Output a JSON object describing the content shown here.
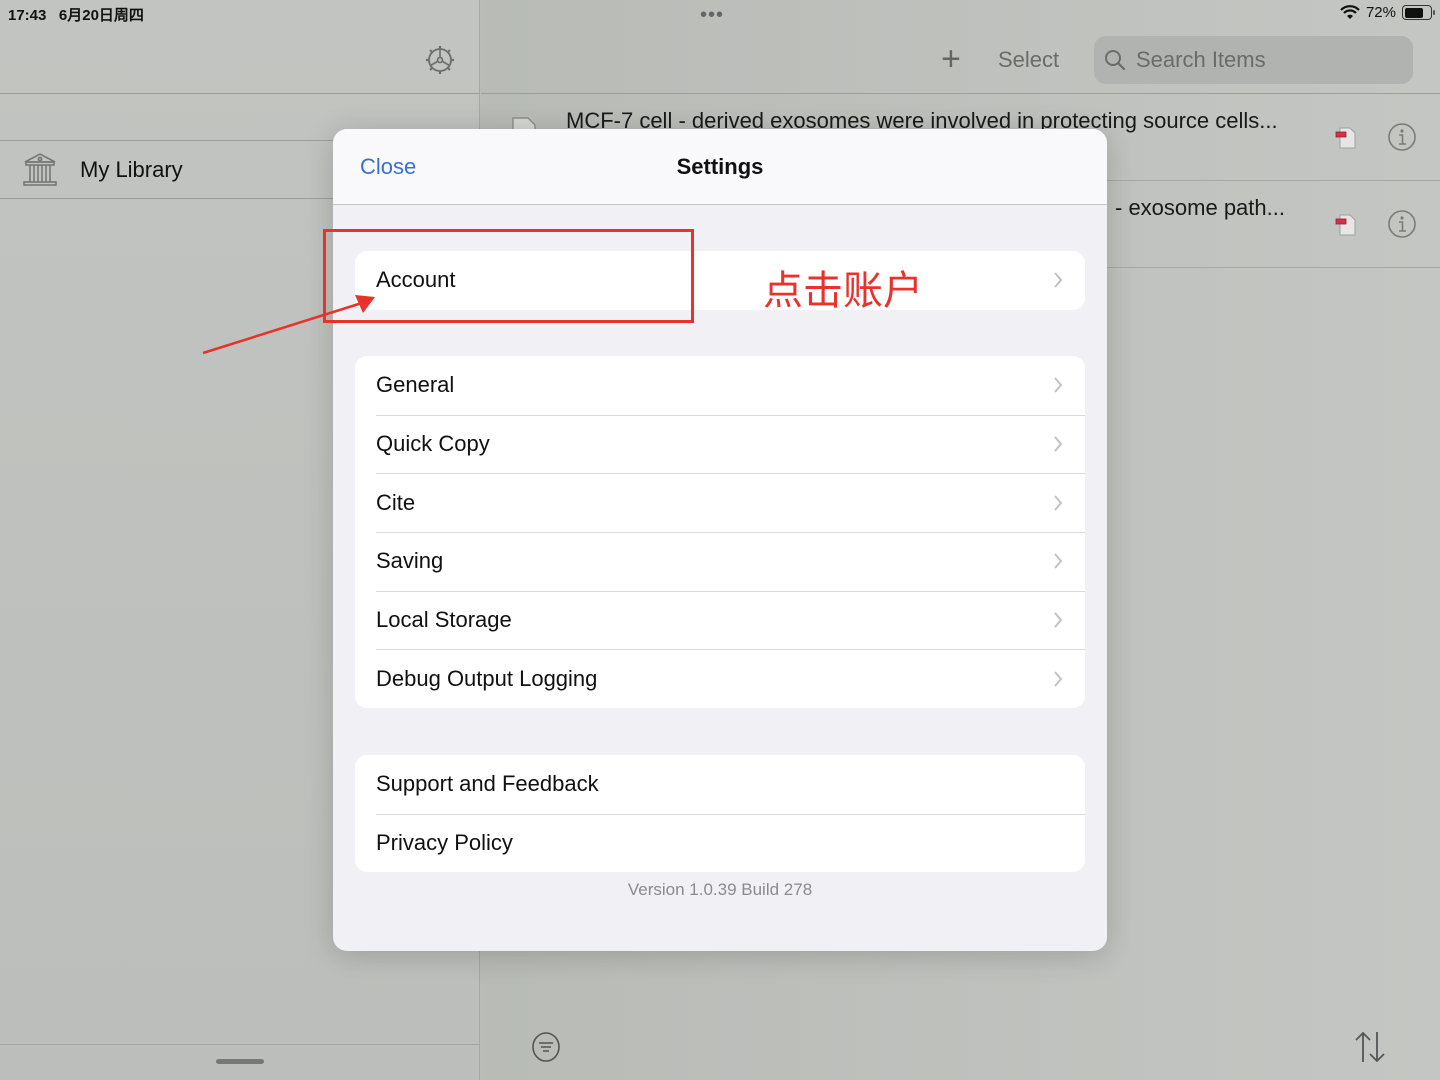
{
  "status_bar": {
    "time": "17:43",
    "date": "6月20日周四",
    "multitask_dots": "•••",
    "battery_percent": "72%",
    "battery_level": 0.72
  },
  "sidebar": {
    "settings_icon": "gear-icon",
    "items": [
      {
        "label": "My Library",
        "icon": "library-icon"
      }
    ]
  },
  "toolbar": {
    "add_icon": "+",
    "select_label": "Select",
    "search_placeholder": "Search Items"
  },
  "items": [
    {
      "title": "MCF-7 cell - derived exosomes were involved in protecting source cells...",
      "attachment": "pdf-icon"
    },
    {
      "title": "- exosome path...",
      "attachment": "pdf-icon"
    }
  ],
  "settings_modal": {
    "title": "Settings",
    "close_label": "Close",
    "groups": [
      {
        "rows": [
          {
            "label": "Account",
            "chevron": true
          }
        ]
      },
      {
        "rows": [
          {
            "label": "General",
            "chevron": true
          },
          {
            "label": "Quick Copy",
            "chevron": true
          },
          {
            "label": "Cite",
            "chevron": true
          },
          {
            "label": "Saving",
            "chevron": true
          },
          {
            "label": "Local Storage",
            "chevron": true
          },
          {
            "label": "Debug Output Logging",
            "chevron": true
          }
        ]
      },
      {
        "rows": [
          {
            "label": "Support and Feedback",
            "chevron": false
          },
          {
            "label": "Privacy Policy",
            "chevron": false
          }
        ]
      }
    ],
    "version": "Version 1.0.39 Build 278"
  },
  "annotation": {
    "text": "点击账户",
    "color": "#e8322c"
  },
  "colors": {
    "accent": "#3a6fd0",
    "annotation": "#e8322c"
  }
}
